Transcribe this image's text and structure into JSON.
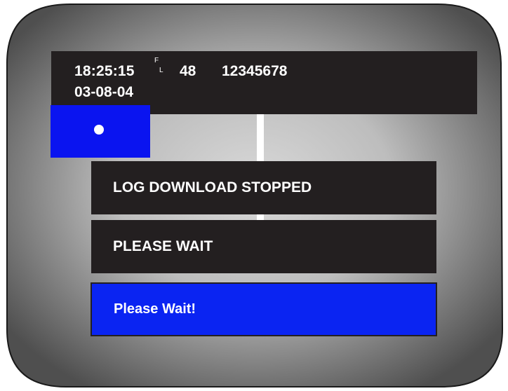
{
  "status_bar": {
    "time": "18:25:15",
    "flag_top": "F",
    "flag_bottom": "L",
    "channel": "48",
    "serial": "12345678",
    "date": "03-08-04"
  },
  "messages": [
    "LOG DOWNLOAD STOPPED",
    "PLEASE WAIT"
  ],
  "wait_button": {
    "label": "Please Wait!"
  },
  "colors": {
    "panel": "#231f20",
    "accent_blue": "#0a14f0",
    "text": "#ffffff",
    "bezel_outer": "#5a5a5a",
    "bezel_inner": "#c8c8c8"
  }
}
